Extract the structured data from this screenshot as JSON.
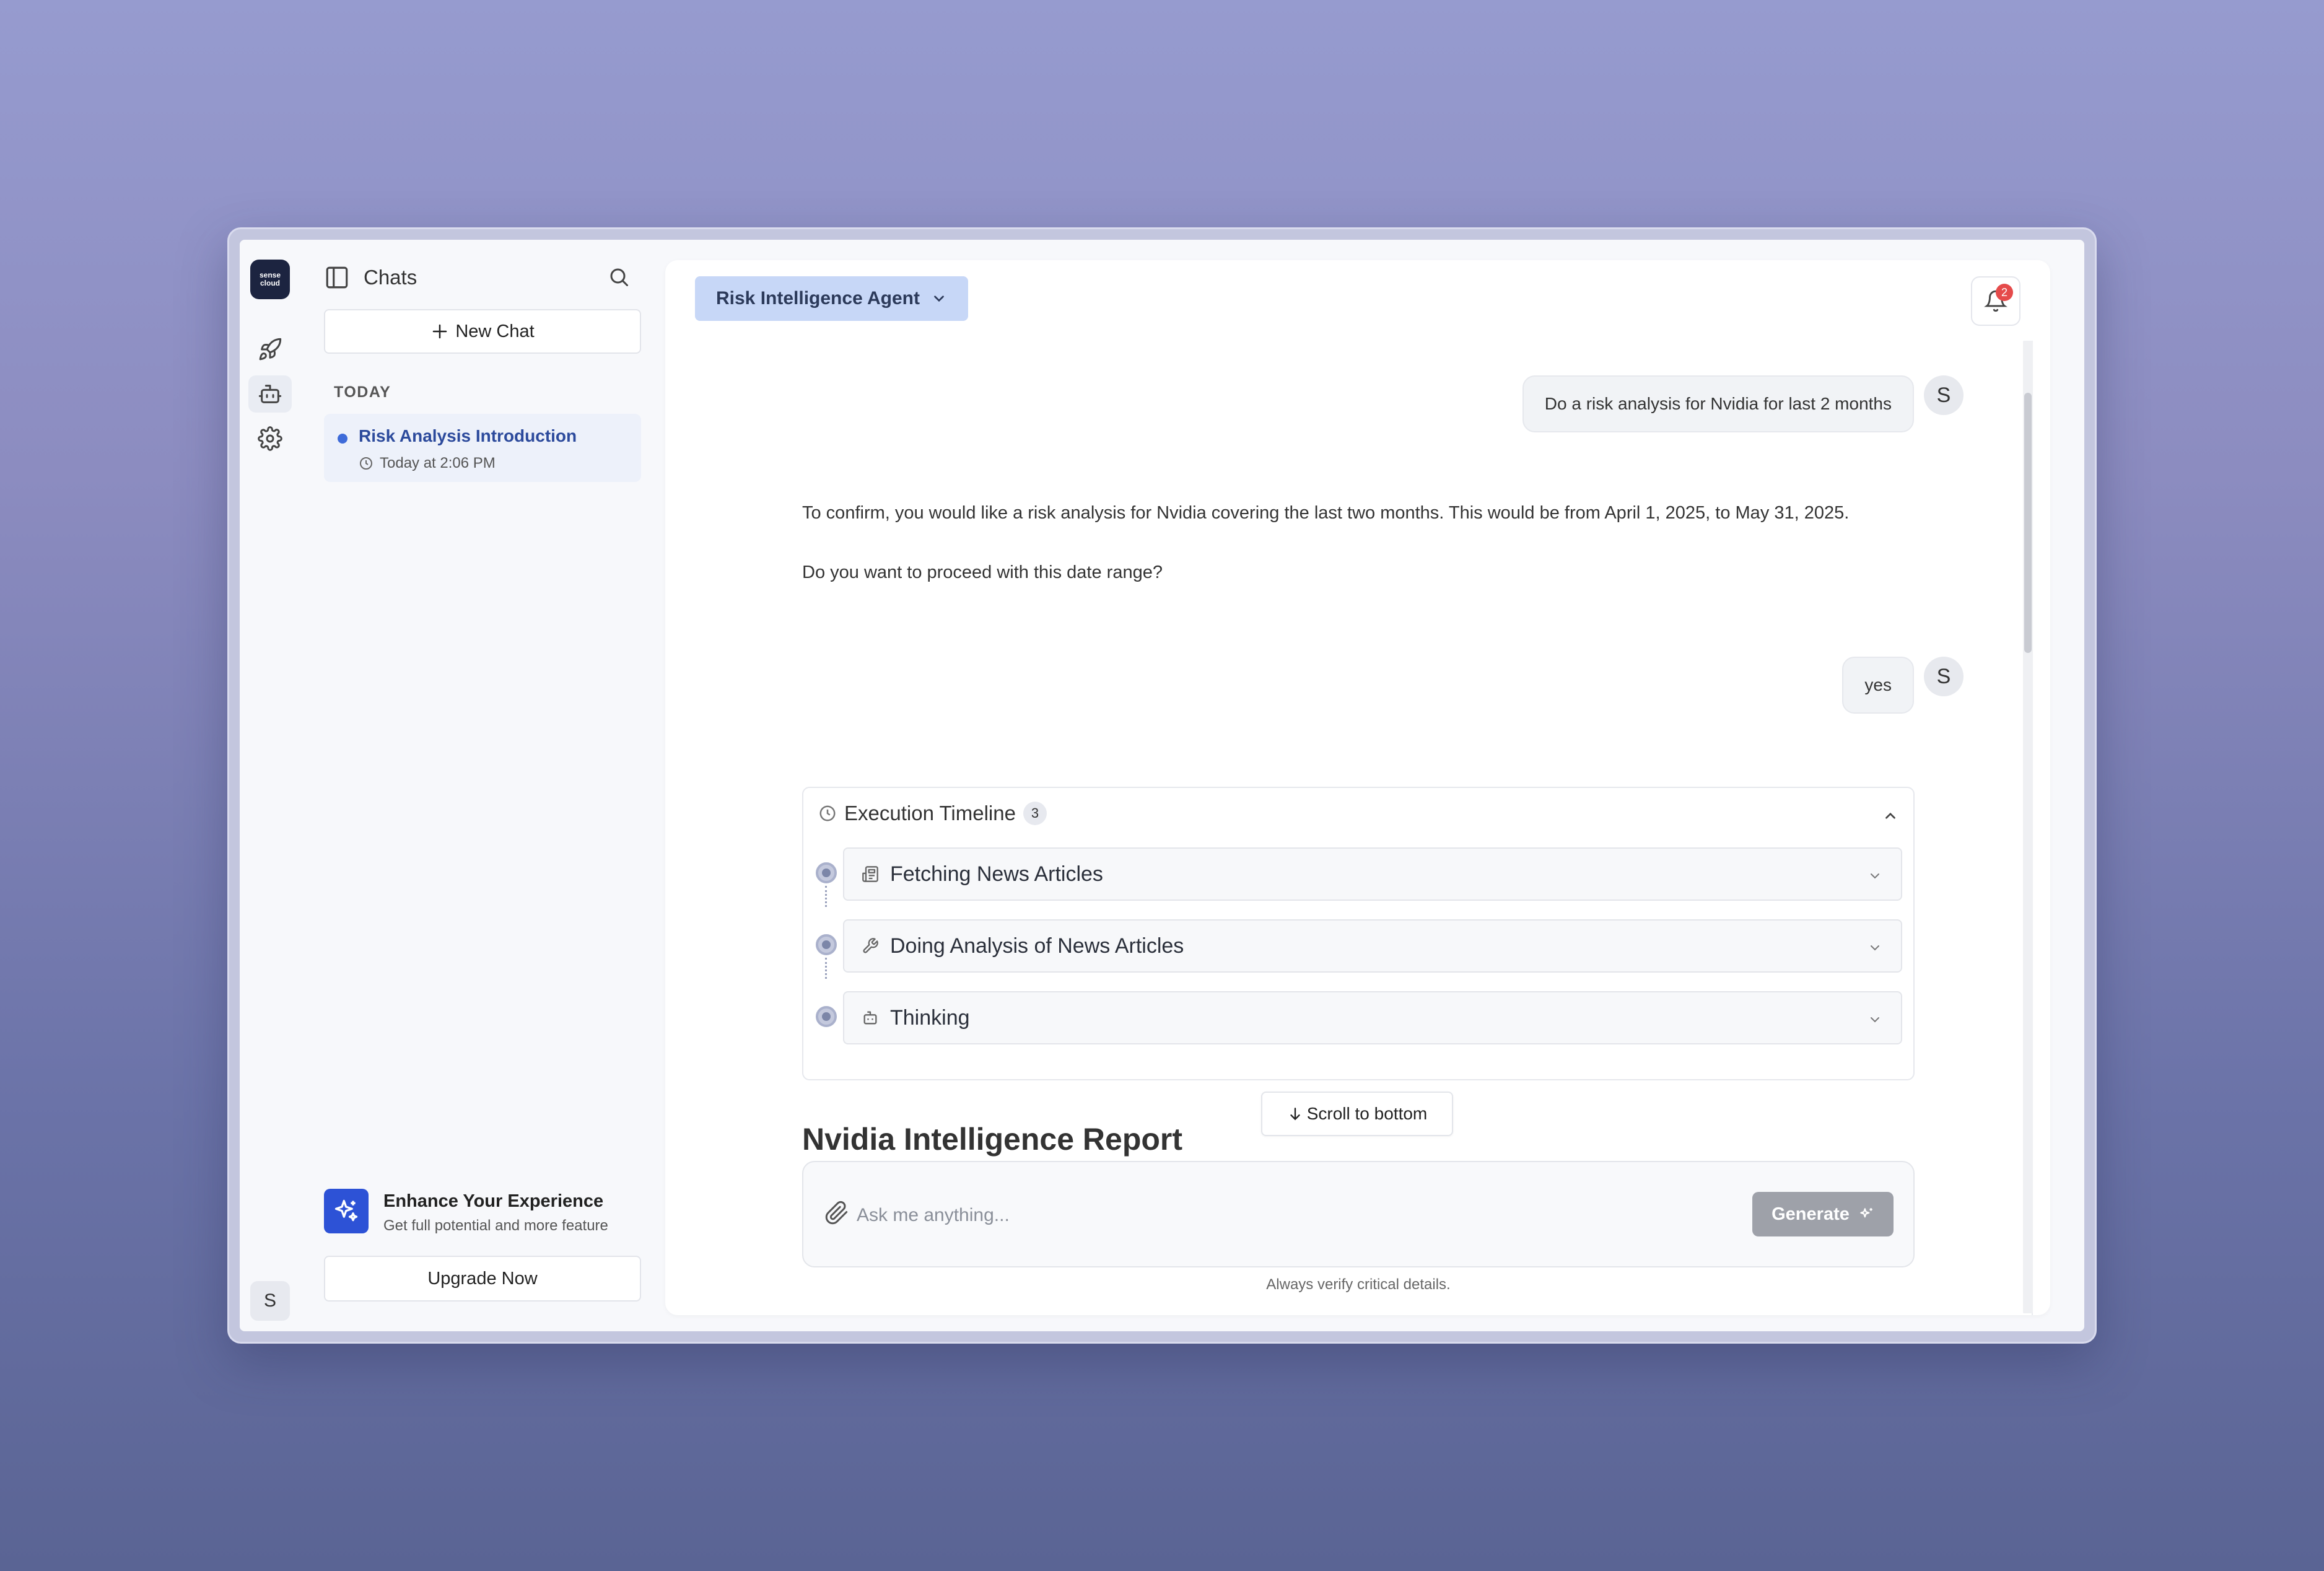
{
  "rail": {
    "logo_line1": "sense",
    "logo_line2": "cloud",
    "avatar": "S",
    "icons": [
      "rocket-icon",
      "robot-icon",
      "gear-icon"
    ]
  },
  "sidebar": {
    "title": "Chats",
    "new_chat": "New Chat",
    "section": "TODAY",
    "chats": [
      {
        "title": "Risk Analysis Introduction",
        "time": "Today at 2:06 PM"
      }
    ],
    "promo_title": "Enhance Your Experience",
    "promo_sub": "Get full potential and more feature",
    "upgrade": "Upgrade Now"
  },
  "header": {
    "agent": "Risk Intelligence Agent",
    "notifications": "2"
  },
  "messages": {
    "user1": "Do a risk analysis for Nvidia for last 2 months",
    "user_avatar": "S",
    "bot1_line1": "To confirm, you would like a risk analysis for Nvidia covering the last two months. This would be from April 1, 2025, to May 31, 2025.",
    "bot1_line2": "Do you want to proceed with this date range?",
    "user2": "yes"
  },
  "timeline": {
    "title": "Execution Timeline",
    "count": "3",
    "steps": [
      {
        "label": "Fetching News Articles",
        "icon": "newspaper-icon"
      },
      {
        "label": "Doing Analysis of News Articles",
        "icon": "wrench-icon"
      },
      {
        "label": "Thinking",
        "icon": "robot-icon"
      }
    ]
  },
  "scroll_bottom": "Scroll to bottom",
  "report_title": "Nvidia Intelligence Report",
  "composer": {
    "placeholder": "Ask me anything...",
    "generate": "Generate",
    "disclaimer": "Always verify critical details."
  },
  "colors": {
    "accent": "#2d52d6",
    "agent_button": "#c7d7f7",
    "badge": "#e54b4b"
  }
}
